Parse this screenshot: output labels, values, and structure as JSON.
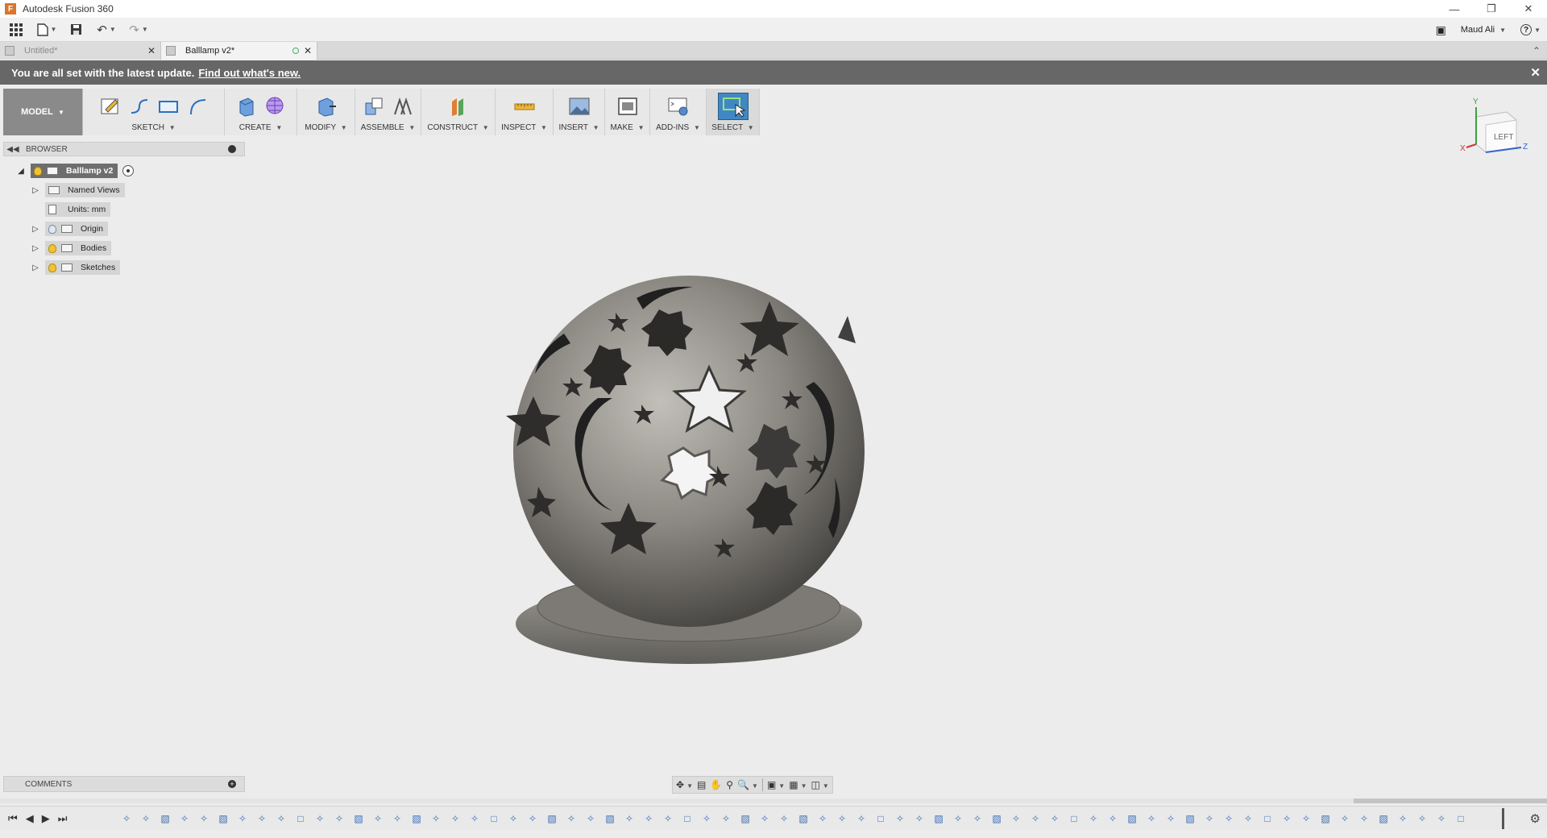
{
  "window": {
    "title": "Autodesk Fusion 360",
    "minimize_icon": "minimize-icon",
    "restore_icon": "restore-icon",
    "close_icon": "close-icon"
  },
  "qat": {
    "user_name": "Maud Ali",
    "help_label": "?"
  },
  "tabs": [
    {
      "label": "Untitled*",
      "active": false
    },
    {
      "label": "Balllamp v2*",
      "active": true
    }
  ],
  "notification": {
    "message": "You are all set with the latest update.",
    "link": "Find out what's new."
  },
  "ribbon": {
    "mode": "MODEL",
    "groups": [
      "SKETCH",
      "CREATE",
      "MODIFY",
      "ASSEMBLE",
      "CONSTRUCT",
      "INSPECT",
      "INSERT",
      "MAKE",
      "ADD-INS",
      "SELECT"
    ]
  },
  "viewcube": {
    "face": "LEFT",
    "axis_y": "Y",
    "axis_z": "Z",
    "axis_x": "X"
  },
  "browser": {
    "title": "BROWSER",
    "root": "Balllamp v2",
    "items": [
      {
        "label": "Named Views",
        "expandable": true,
        "bulb": "none"
      },
      {
        "label": "Units: mm",
        "expandable": false,
        "bulb": "none"
      },
      {
        "label": "Origin",
        "expandable": true,
        "bulb": "off"
      },
      {
        "label": "Bodies",
        "expandable": true,
        "bulb": "on"
      },
      {
        "label": "Sketches",
        "expandable": true,
        "bulb": "on"
      }
    ]
  },
  "comments": {
    "title": "COMMENTS"
  },
  "colors": {
    "notify_bar": "#676767",
    "mode_bg": "#8a8a8a",
    "select_accent": "#3f88c5",
    "model_metal": "#8d8a84"
  }
}
